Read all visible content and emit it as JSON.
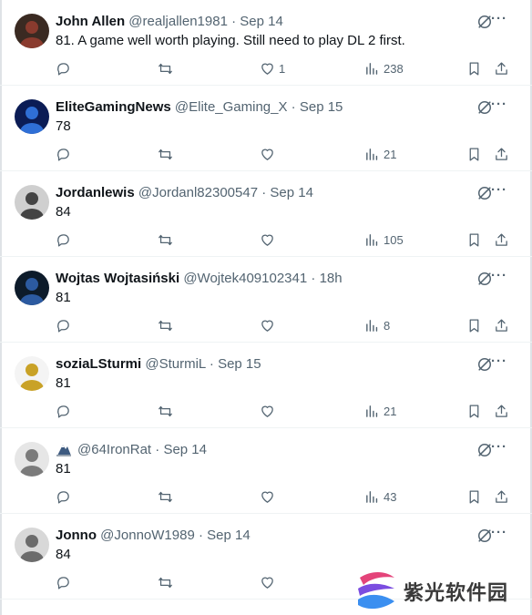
{
  "tweets": [
    {
      "name": "John Allen",
      "handle": "@realjallen1981",
      "time": "Sep 14",
      "text": "81. A game well worth playing. Still need to play DL 2 first.",
      "likes": "1",
      "views": "238",
      "avatar": "#3a2a22",
      "avatar2": "#8a3b2e"
    },
    {
      "name": "EliteGamingNews",
      "handle": "@Elite_Gaming_X",
      "time": "Sep 15",
      "text": "78",
      "likes": "",
      "views": "21",
      "avatar": "#0b1c55",
      "avatar2": "#2f6fd6"
    },
    {
      "name": "Jordanlewis",
      "handle": "@Jordanl82300547",
      "time": "Sep 14",
      "text": "84",
      "likes": "",
      "views": "105",
      "avatar": "#cfcfcf",
      "avatar2": "#444444"
    },
    {
      "name": "Wojtas Wojtasiński",
      "handle": "@Wojtek409102341",
      "time": "18h",
      "text": "81",
      "likes": "",
      "views": "8",
      "avatar": "#0d1b2a",
      "avatar2": "#2c5aa0"
    },
    {
      "name": "soziaLSturmi",
      "handle": "@SturmiL",
      "time": "Sep 15",
      "text": "81",
      "likes": "",
      "views": "21",
      "avatar": "#f4f4f4",
      "avatar2": "#c9a227"
    },
    {
      "name": "",
      "handle": "@64IronRat",
      "time": "Sep 14",
      "text": "81",
      "likes": "",
      "views": "43",
      "avatar": "#e6e6e6",
      "avatar2": "#7b7b7b"
    },
    {
      "name": "Jonno",
      "handle": "@JonnoW1989",
      "time": "Sep 14",
      "text": "84",
      "likes": "",
      "views": "",
      "avatar": "#d8d8d8",
      "avatar2": "#6b6b6b"
    }
  ],
  "watermark": {
    "text": "紫光软件园"
  },
  "icons": [
    "reply-icon",
    "retweet-icon",
    "like-icon",
    "views-icon",
    "bookmark-icon",
    "share-icon",
    "grok-icon",
    "more-icon"
  ]
}
